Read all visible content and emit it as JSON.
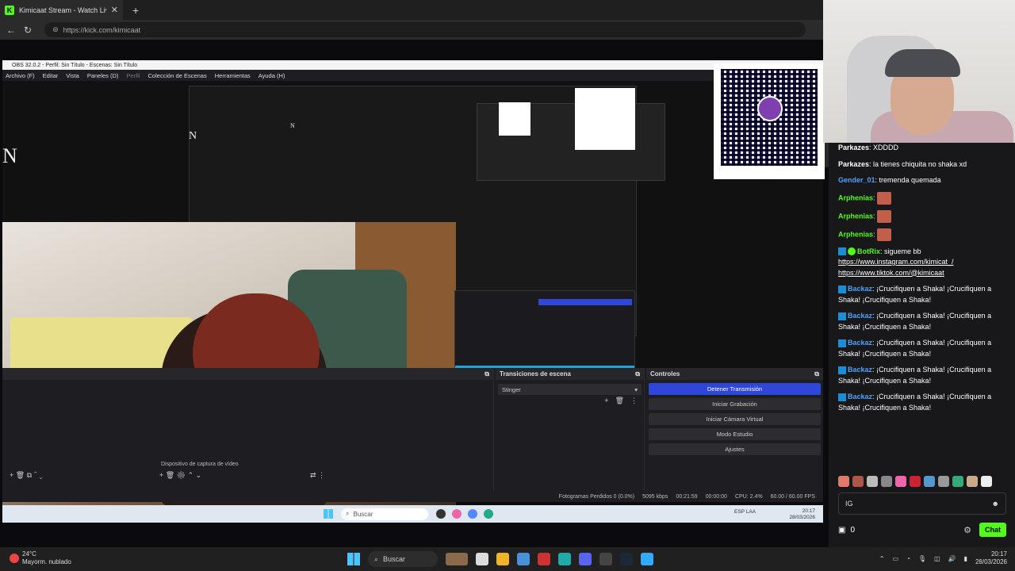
{
  "browser": {
    "tab_title": "Kimicaat Stream - Watch Live on K",
    "url": "https://kick.com/kimicaat",
    "new_tab": "+",
    "close": "✕"
  },
  "obs": {
    "title_bar": "OBS 32.0.2 - Perfil: Sin Título - Escenas: Sin Título",
    "menu": [
      "Archivo (F)",
      "Editar",
      "Vista",
      "Paneles (D)",
      "Perfil",
      "Colección de Escenas",
      "Herramientas",
      "Ayuda (H)"
    ],
    "big_letter": "N",
    "transitions_header": "Transiciones de escena",
    "transition_value": "Stinger",
    "controls_header": "Controles",
    "controls": [
      "Detener Transmisión",
      "Iniciar Grabación",
      "Iniciar Cámara Virtual",
      "Modo Estudio",
      "Ajustes"
    ],
    "source_label": "Dispositivo de captura de vídeo",
    "status": {
      "frames": "Fotogramas Perdidos 0 (0.0%)",
      "bitrate": "5095 kbps",
      "stream_time": "00:21:59",
      "rec_time": "00:00:00",
      "cpu": "CPU: 2.4%",
      "fps": "60.00 / 60.00 FPS"
    },
    "inner_taskbar": {
      "search": "Buscar",
      "lang": "ESP LAA",
      "time": "20:17",
      "date": "28/03/2026"
    }
  },
  "chat": {
    "messages": [
      {
        "user": "Parkazes",
        "text": ": XDDDD"
      },
      {
        "user": "Parkazes",
        "text": ": la tienes chiquita no shaka xd"
      },
      {
        "user": "Gender_01",
        "text": ": tremenda quemada"
      },
      {
        "user": "Arphenias",
        "text": ":"
      },
      {
        "user": "Arphenias",
        "text": ":"
      },
      {
        "user": "Arphenias",
        "text": ":"
      },
      {
        "user": "BotRix",
        "text": ": sigueme bb",
        "links": [
          "https://www.instagram.com/kimicat_/",
          "https://www.tiktok.com/@kimicaat"
        ]
      },
      {
        "user": "Backaz",
        "text": ": ¡Crucifiquen a Shaka! ¡Crucifiquen a Shaka! ¡Crucifiquen a Shaka!"
      },
      {
        "user": "Backaz",
        "text": ": ¡Crucifiquen a Shaka! ¡Crucifiquen a Shaka! ¡Crucifiquen a Shaka!"
      },
      {
        "user": "Backaz",
        "text": ": ¡Crucifiquen a Shaka! ¡Crucifiquen a Shaka! ¡Crucifiquen a Shaka!"
      },
      {
        "user": "Backaz",
        "text": ": ¡Crucifiquen a Shaka! ¡Crucifiquen a Shaka! ¡Crucifiquen a Shaka!"
      },
      {
        "user": "Backaz",
        "text": ": ¡Crucifiquen a Shaka! ¡Crucifiquen a Shaka! ¡Crucifiquen a Shaka!"
      }
    ],
    "input_value": "IG",
    "points": "0",
    "send_label": "Chat"
  },
  "taskbar": {
    "temp": "24°C",
    "weather": "Mayorm. nublado",
    "search": "Buscar",
    "time": "20:17",
    "date": "28/03/2026"
  },
  "colors": {
    "kick_green": "#53fc18",
    "obs_blue": "#2f47d8"
  }
}
